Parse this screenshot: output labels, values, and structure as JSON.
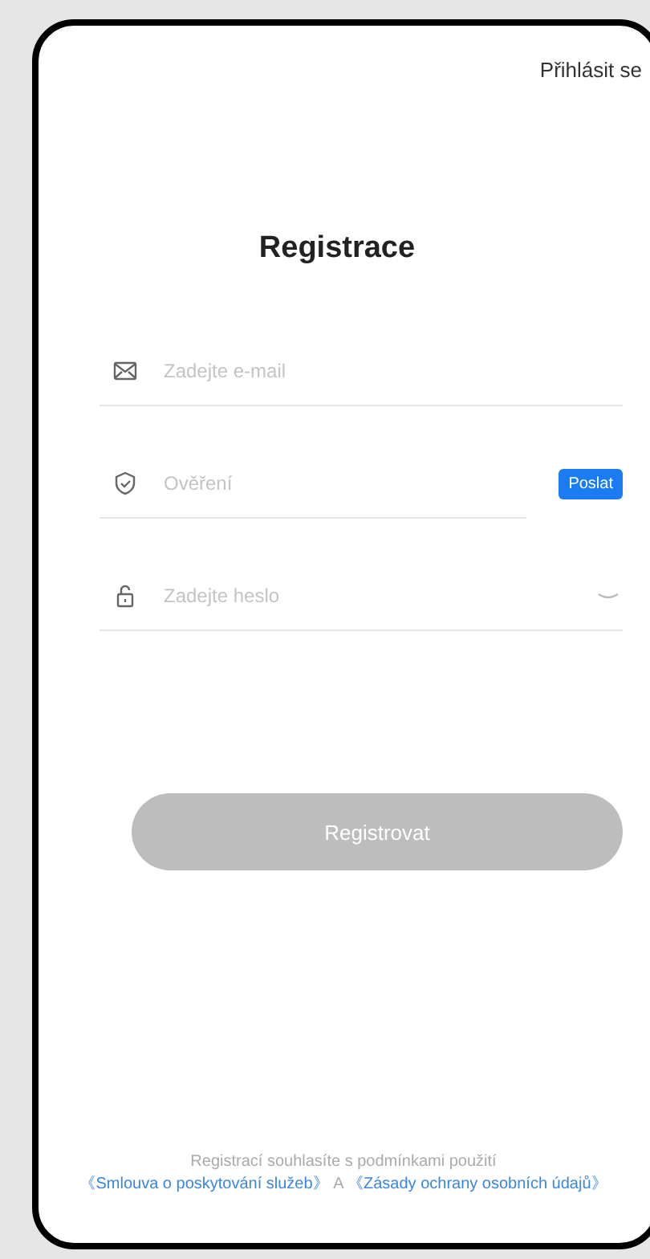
{
  "header": {
    "login_link": "Přihlásit se"
  },
  "title": "Registrace",
  "fields": [
    {
      "kind": "email",
      "placeholder": "Zadejte e-mail"
    },
    {
      "kind": "code",
      "placeholder": "Ověření",
      "button": "Poslat"
    },
    {
      "kind": "password",
      "placeholder": "Zadejte heslo"
    }
  ],
  "submit": {
    "label": "Registrovat",
    "disabled": true
  },
  "footer": {
    "text": "Registrací souhlasíte s podmínkami použití",
    "link_1": "《Smlouva o poskytování služeb》",
    "conjunction": "A",
    "link_2": "《Zásady ochrany osobních údajů》"
  }
}
